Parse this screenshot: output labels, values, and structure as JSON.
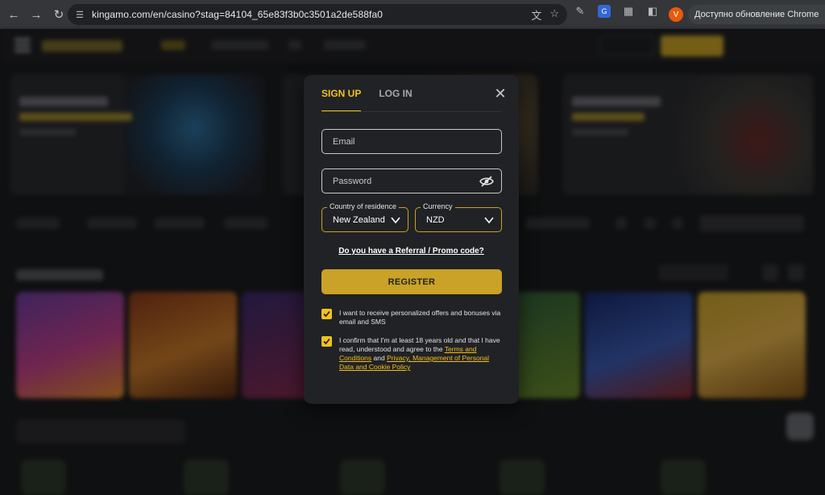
{
  "browser": {
    "url": "kingamo.com/en/casino?stag=84104_65e83f3b0c3501a2de588fa0",
    "update_label": "Доступно обновление Chrome",
    "profile_initial": "V"
  },
  "modal": {
    "tabs": [
      {
        "label": "SIGN UP",
        "active": true
      },
      {
        "label": "LOG IN",
        "active": false
      }
    ],
    "email_placeholder": "Email",
    "password_placeholder": "Password",
    "country": {
      "label": "Country of residence",
      "value": "New Zealand"
    },
    "currency": {
      "label": "Currency",
      "value": "NZD"
    },
    "promo_link": "Do you have a Referral / Promo code?",
    "register_label": "REGISTER",
    "consent_offers": "I want to receive personalized offers and bonuses via email and SMS",
    "consent_age_text": "I confirm that I'm at least 18 years old and that I have read, understood and agree to the",
    "terms_link": "Terms and Conditions",
    "and_text": "and",
    "privacy_link": "Privacy, Management of Personal Data and Cookie Policy"
  },
  "colors": {
    "accent": "#f2c21b",
    "button": "#c9a227",
    "modal_bg": "#212225"
  }
}
